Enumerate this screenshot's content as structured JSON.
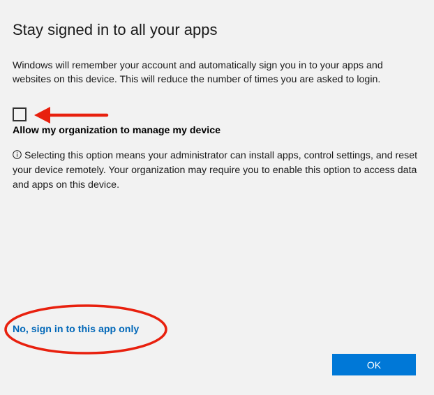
{
  "dialog": {
    "title": "Stay signed in to all your apps",
    "description": "Windows will remember your account and automatically sign you in to your apps and websites on this device. This will reduce the number of times you are asked to login.",
    "manage_option": {
      "checked": false,
      "label": "Allow my organization to manage my device",
      "info_icon": "info-icon",
      "info_text": "Selecting this option means your administrator can install apps, control settings, and reset your device remotely. Your organization may require you to enable this option to access data and apps on this device."
    },
    "app_only_link": "No, sign in to this app only",
    "ok_label": "OK"
  },
  "annotations": {
    "arrow": "arrow-left-icon",
    "circle": "ellipse-highlight",
    "color": "#e8200e"
  },
  "colors": {
    "background": "#f2f2f2",
    "accent": "#0078d7",
    "link": "#0067b8"
  }
}
